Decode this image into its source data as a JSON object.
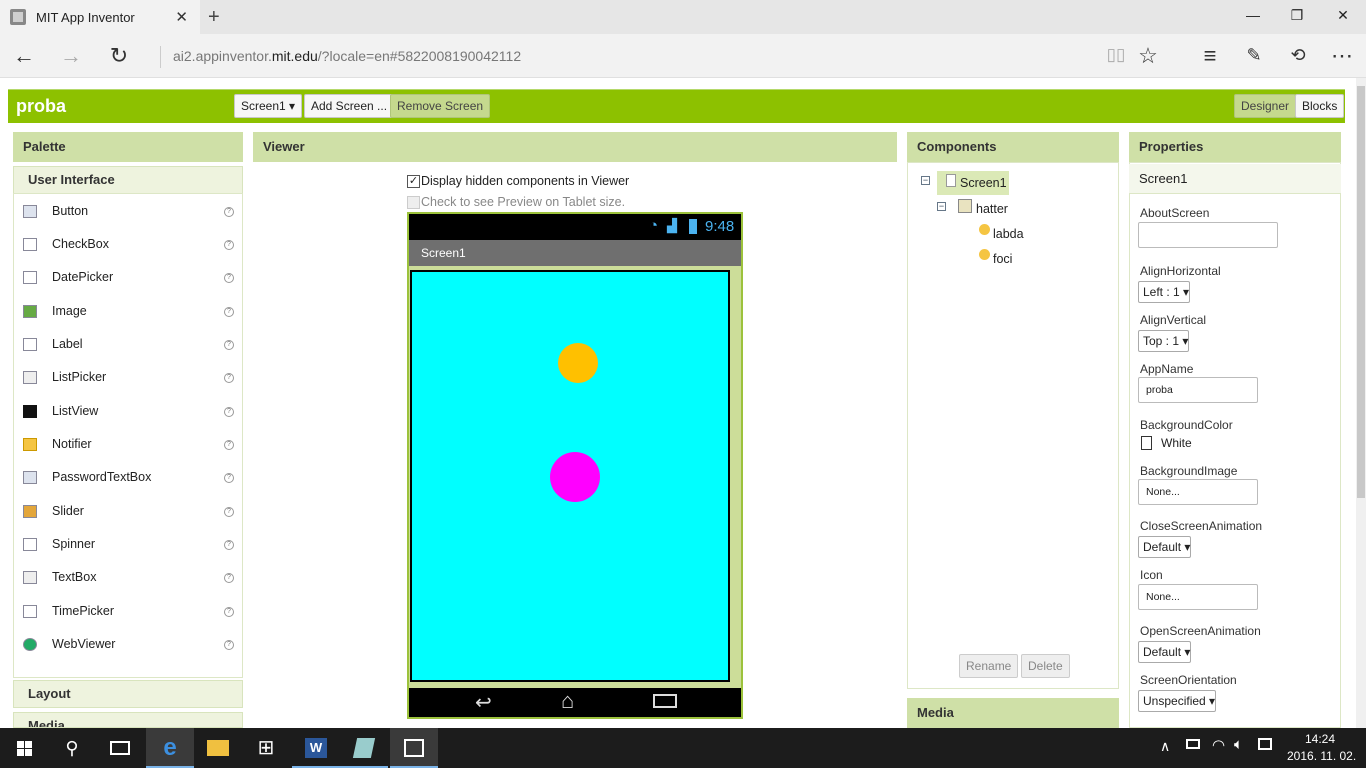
{
  "browser": {
    "tab_title": "MIT App Inventor",
    "url_prefix": "ai2.appinventor.",
    "url_domain": "mit.edu",
    "url_suffix": "/?locale=en#5822008190042112"
  },
  "app": {
    "name": "proba",
    "screen_select": "Screen1 ▾",
    "add_screen": "Add Screen ...",
    "remove_screen": "Remove Screen",
    "designer": "Designer",
    "blocks": "Blocks"
  },
  "palette": {
    "title": "Palette",
    "section": "User Interface",
    "items": [
      "Button",
      "CheckBox",
      "DatePicker",
      "Image",
      "Label",
      "ListPicker",
      "ListView",
      "Notifier",
      "PasswordTextBox",
      "Slider",
      "Spinner",
      "TextBox",
      "TimePicker",
      "WebViewer"
    ],
    "help": "?",
    "layout": "Layout",
    "media": "Media"
  },
  "viewer": {
    "title": "Viewer",
    "hidden_label": "Display hidden components in Viewer",
    "tablet_label": "Check to see Preview on Tablet size.",
    "clock": "9:48",
    "screen_title": "Screen1",
    "canvas_color": "#00ffff",
    "sprite1_color": "#ffc000",
    "sprite2_color": "#ff00ff"
  },
  "components": {
    "title": "Components",
    "screen": "Screen1",
    "canvas": "hatter",
    "sprite1": "labda",
    "sprite2": "foci",
    "rename": "Rename",
    "delete": "Delete",
    "media": "Media"
  },
  "properties": {
    "title": "Properties",
    "object": "Screen1",
    "about": "AboutScreen",
    "alignh": "AlignHorizontal",
    "alignh_val": "Left : 1 ▾",
    "alignv": "AlignVertical",
    "alignv_val": "Top : 1 ▾",
    "appname": "AppName",
    "appname_val": "proba",
    "bgcolor": "BackgroundColor",
    "bgcolor_val": "White",
    "bgimage": "BackgroundImage",
    "bgimage_val": "None...",
    "closeanim": "CloseScreenAnimation",
    "closeanim_val": "Default ▾",
    "icon": "Icon",
    "icon_val": "None...",
    "openanim": "OpenScreenAnimation",
    "openanim_val": "Default ▾",
    "orient": "ScreenOrientation",
    "orient_val": "Unspecified ▾"
  },
  "taskbar": {
    "time": "14:24",
    "date": "2016. 11. 02."
  },
  "colors": {
    "accent": "#8dc100",
    "panel_header": "#cfe0a7"
  }
}
